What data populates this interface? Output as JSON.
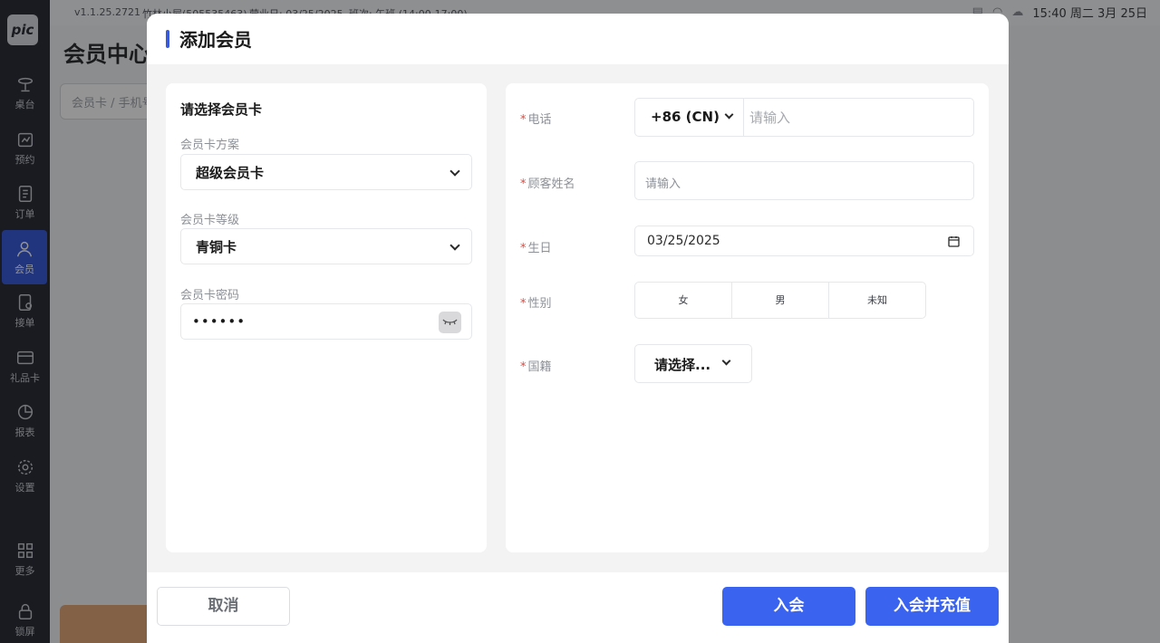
{
  "app": {
    "logo_text": "pic",
    "version": "v1.1.25.2721",
    "store": "竹林小屋(505535463)",
    "business_day": "营业日: 03/25/2025",
    "shift": "班次: 午班 (14:00-17:00)",
    "clock": "15:40 周二 3月 25日"
  },
  "sidebar": {
    "items": [
      {
        "label": "桌台",
        "icon": "table-service-icon"
      },
      {
        "label": "预约",
        "icon": "calendar-icon"
      },
      {
        "label": "订单",
        "icon": "order-icon"
      },
      {
        "label": "会员",
        "icon": "user-icon",
        "active": true
      },
      {
        "label": "接单",
        "icon": "accept-order-icon"
      },
      {
        "label": "礼品卡",
        "icon": "gift-card-icon"
      },
      {
        "label": "报表",
        "icon": "pie-chart-icon"
      },
      {
        "label": "设置",
        "icon": "gear-icon"
      },
      {
        "label": "更多",
        "icon": "grid-icon"
      },
      {
        "label": "锁屏",
        "icon": "lock-icon"
      }
    ]
  },
  "background": {
    "page_title": "会员中心",
    "search_placeholder": "会员卡 / 手机号"
  },
  "modal": {
    "title": "添加会员",
    "card": {
      "section_title": "请选择会员卡",
      "plan_label": "会员卡方案",
      "plan_value": "超级会员卡",
      "level_label": "会员卡等级",
      "level_value": "青铜卡",
      "password_label": "会员卡密码",
      "password_value": "••••••"
    },
    "form": {
      "phone_label": "电话",
      "country_code": "+86 (CN)",
      "phone_placeholder": "请输入",
      "name_label": "顾客姓名",
      "name_placeholder": "请输入",
      "birthday_label": "生日",
      "birthday_value": "03/25/2025",
      "gender_label": "性别",
      "gender_options": [
        "女",
        "男",
        "未知"
      ],
      "nationality_label": "国籍",
      "nationality_value": "请选择..."
    },
    "footer": {
      "cancel": "取消",
      "join": "入会",
      "join_recharge": "入会并充值"
    }
  },
  "colors": {
    "accent": "#3a63f0",
    "required": "#e5483f",
    "sidebar_bg": "#2b2f3a"
  }
}
